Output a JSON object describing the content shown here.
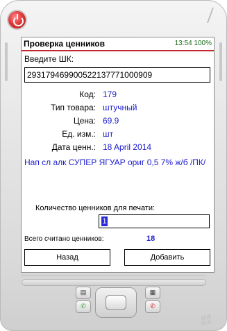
{
  "app": {
    "title": "Проверка ценников",
    "status_time": "13:54",
    "battery": "100%"
  },
  "form": {
    "scan_label": "Введите ШК:",
    "barcode_value": "293179469900522137771000909",
    "fields": [
      {
        "label": "Код:",
        "value": "179"
      },
      {
        "label": "Тип товара:",
        "value": "штучный"
      },
      {
        "label": "Цена:",
        "value": "69.9"
      },
      {
        "label": "Ед. изм.:",
        "value": "шт"
      },
      {
        "label": "Дата ценн.:",
        "value": "18 April 2014"
      }
    ],
    "description": "Нап сл алк СУПЕР ЯГУАР ориг 0,5 7% ж/б /ПК/",
    "qty_label": "Количество ценников для печати:",
    "qty_value": "1",
    "total_label": "Всего считано ценников:",
    "total_value": "18"
  },
  "buttons": {
    "back": "Назад",
    "add": "Добавить"
  },
  "icons": {
    "power": "power-icon",
    "call": "phone-call-icon",
    "end": "phone-end-icon",
    "windows": "windows-logo-icon"
  },
  "colors": {
    "title_underline": "#c1272d",
    "value_blue": "#1c1ccf",
    "status_green": "#1a6b1a"
  }
}
